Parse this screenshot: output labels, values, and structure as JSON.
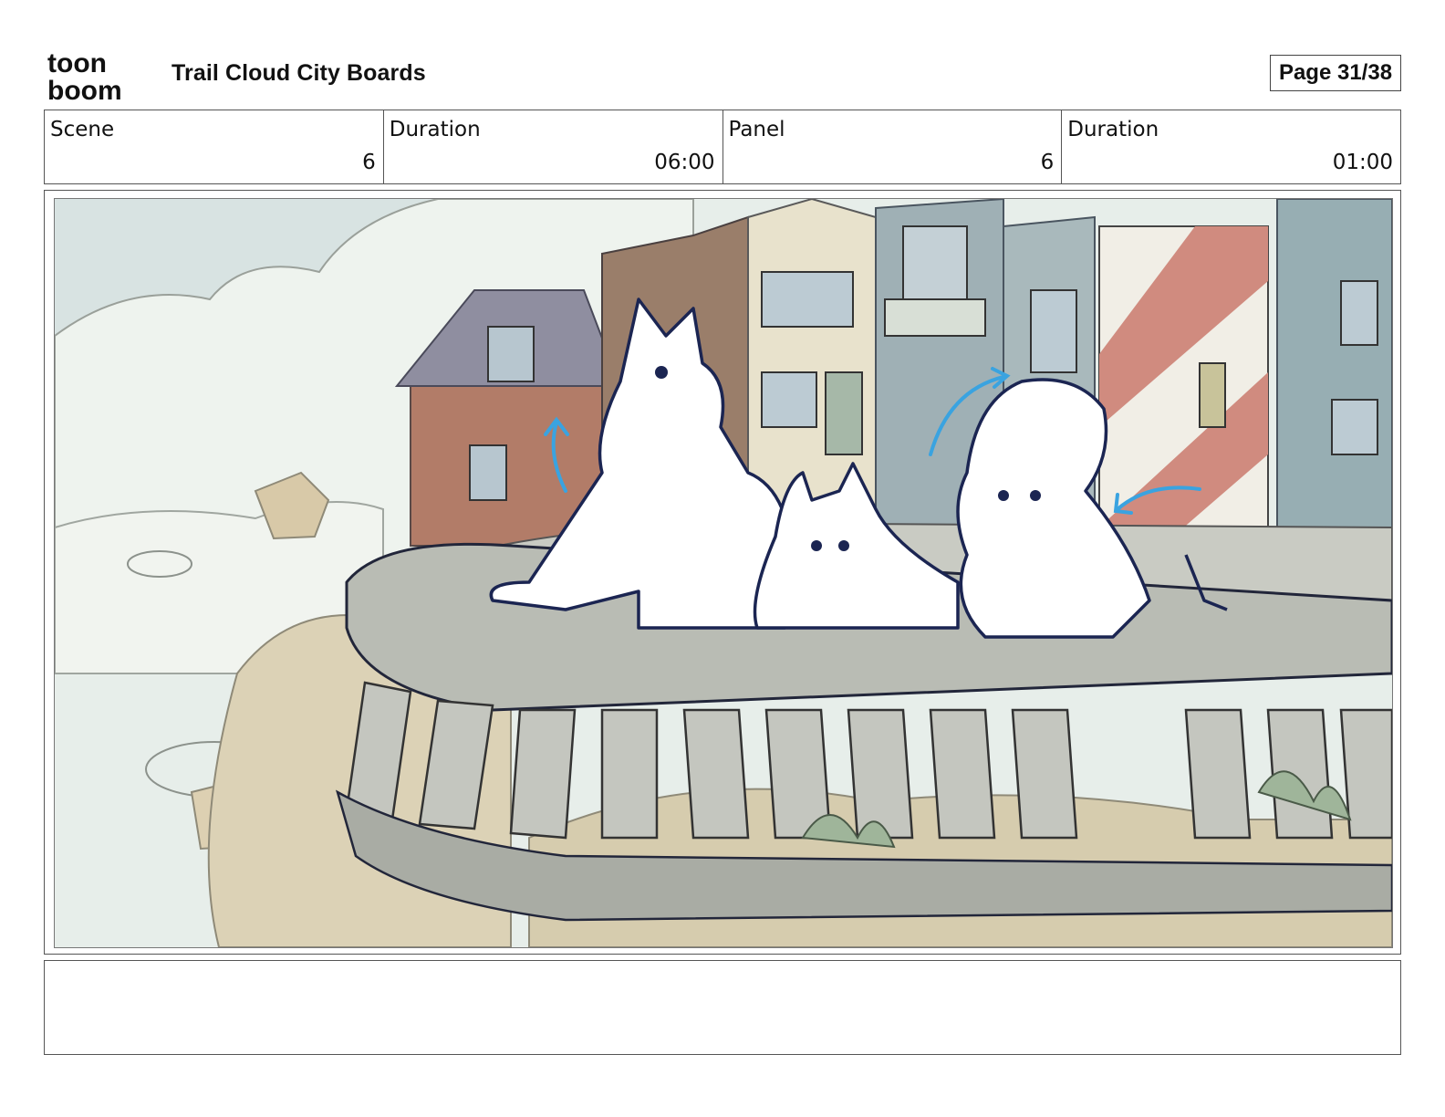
{
  "header": {
    "logo_line1": "toon",
    "logo_line2": "boom",
    "title": "Trail Cloud City Boards",
    "page": "Page 31/38"
  },
  "info": {
    "scene_label": "Scene",
    "scene_value": "6",
    "scene_duration_label": "Duration",
    "scene_duration_value": "06:00",
    "panel_label": "Panel",
    "panel_value": "6",
    "panel_duration_label": "Duration",
    "panel_duration_value": "01:00"
  },
  "notes": {
    "text": ""
  },
  "colors": {
    "sky": "#dde6e3",
    "stone": "#b9bcb4",
    "brick": "#b07a6a",
    "stripe_red": "#d08b7f",
    "ink": "#1b2552",
    "motion_arrow": "#3aa3e0"
  }
}
